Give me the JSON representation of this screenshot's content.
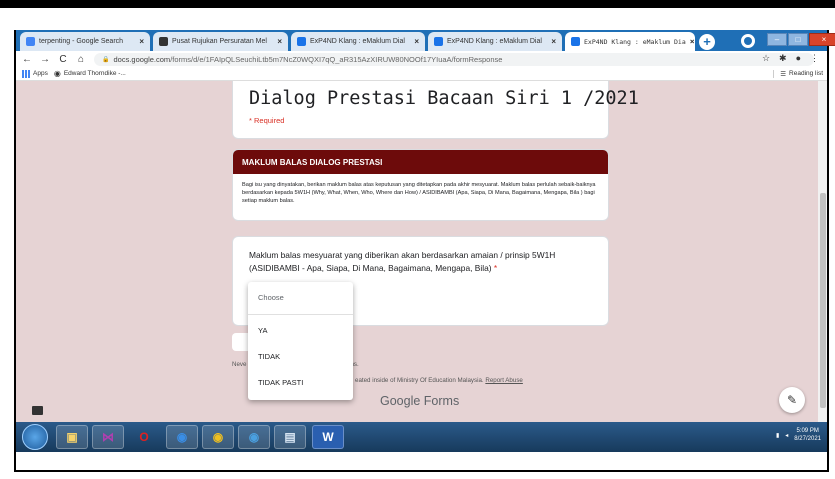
{
  "browser": {
    "tabs": [
      {
        "label": "terpenting - Google Search",
        "icon": "google-icon",
        "color": "#4285f4"
      },
      {
        "label": "Pusat Rujukan Persuratan Mel",
        "icon": "web-icon",
        "color": "#333333"
      },
      {
        "label": "ExP4ND Klang : eMaklum Dial",
        "icon": "forms-icon",
        "color": "#1a73e8"
      },
      {
        "label": "ExP4ND Klang : eMaklum Dial",
        "icon": "forms-icon",
        "color": "#1a73e8"
      },
      {
        "label": "ExP4ND Klang : eMaklum Dia",
        "icon": "forms-icon",
        "color": "#1a73e8"
      }
    ],
    "url_host": "docs.google.com",
    "url_path": "/forms/d/e/1FAIpQLSeuchiLtb5m7NcZ0WQXI7qQ_aR315AzXIRUW80NOOf17YIuaA/formResponse",
    "bookmarks": {
      "apps": "Apps",
      "item1": "Edward Thorndike -...",
      "reading_list": "Reading list"
    }
  },
  "form": {
    "title": "Dialog Prestasi Bacaan Siri 1 /2021",
    "required_note": "* Required",
    "section_title": "MAKLUM BALAS DIALOG PRESTASI",
    "section_description": "Bagi isu yang dinyatakan, berikan maklum balas atas keputusan yang ditetapkan pada akhir mesyuarat. Maklum balas perlulah sebaik-baiknya berdasarkan kepada 5W1H (Why, What, When, Who, Where dan How) / ASIDIBAMBI (Apa, Siapa, Di Mana, Bagaimana, Mengapa, Bila ) bagi setiap maklum balas.",
    "question": "Maklum balas mesyuarat yang diberikan akan berdasarkan amaian / prinsip 5W1H (ASIDIBAMBI - Apa, Siapa, Di Mana, Bagaimana, Mengapa, Bila)",
    "question_required_mark": "*",
    "dropdown": {
      "placeholder": "Choose",
      "options": [
        "YA",
        "TIDAK",
        "TIDAK PASTI"
      ]
    },
    "footer_prefix": "Neve",
    "footer_suffix": "ogle Forms.",
    "footer_line2": "eated inside of Ministry Of Education Malaysia.",
    "report_abuse": "Report Abuse",
    "brand_google": "Google",
    "brand_forms": "Forms"
  },
  "taskbar": {
    "time": "5:09 PM",
    "date": "8/27/2021"
  }
}
